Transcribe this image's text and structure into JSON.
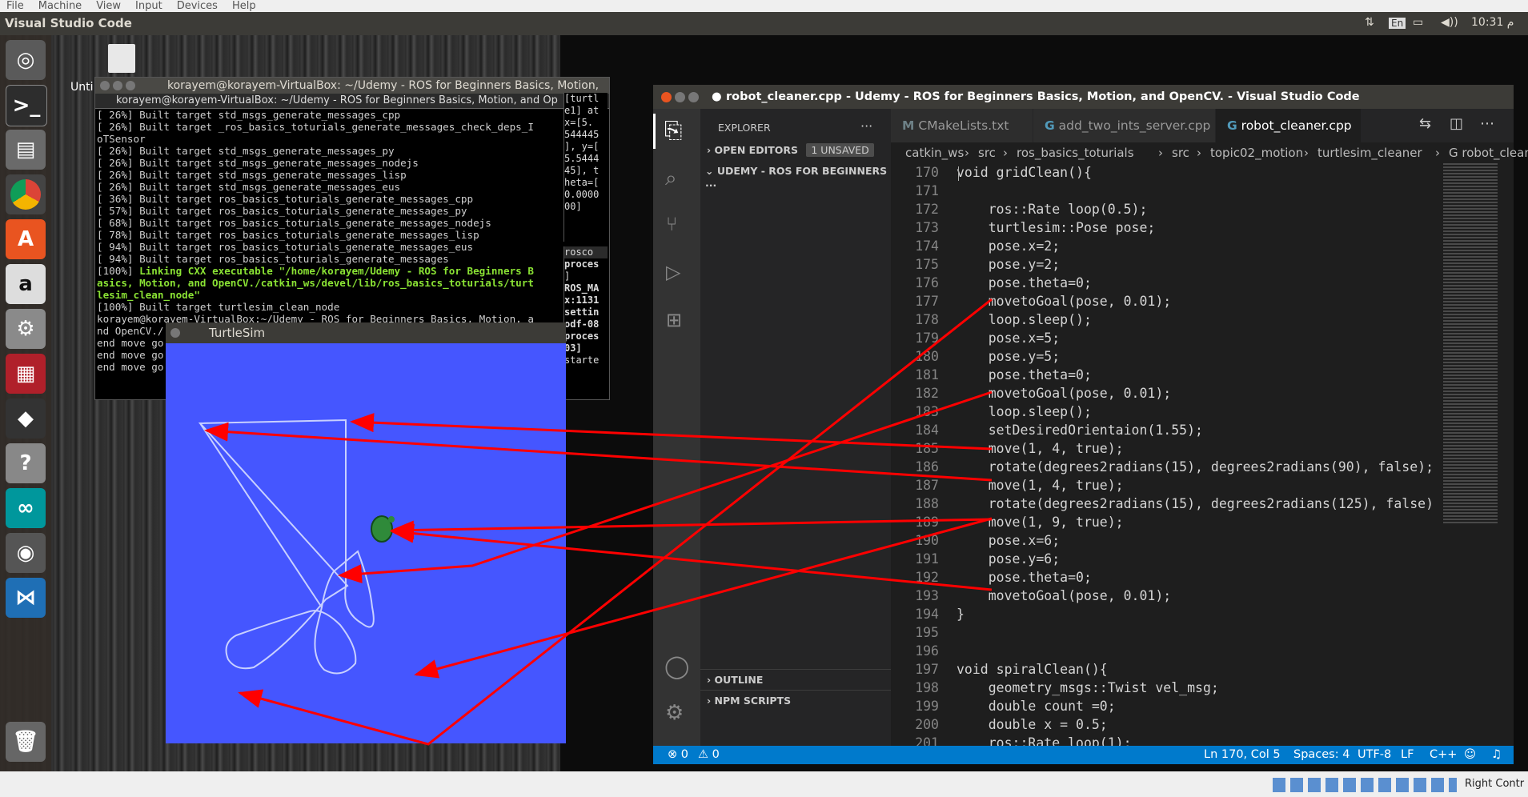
{
  "vbox_menu": [
    "File",
    "Machine",
    "View",
    "Input",
    "Devices",
    "Help"
  ],
  "top_panel": {
    "app_title": "Visual Studio Code",
    "indicators": [
      "⇅",
      "En",
      "▭",
      "◀))",
      "10:31 م"
    ]
  },
  "desktop": {
    "file_label": "Unti"
  },
  "terminal": {
    "window_title": "korayem@korayem-VirtualBox: ~/Udemy - ROS for Beginners Basics, Motion, a",
    "tab1": "korayem@korayem-VirtualBox: ~/Udemy - ROS for Beginners Basics, Motion, and Op",
    "tab2": "kora",
    "lines": [
      "[ 26%] Built target std_msgs_generate_messages_cpp",
      "[ 26%] Built target _ros_basics_toturials_generate_messages_check_deps_I",
      "oTSensor",
      "[ 26%] Built target std_msgs_generate_messages_py",
      "[ 26%] Built target std_msgs_generate_messages_nodejs",
      "[ 26%] Built target std_msgs_generate_messages_lisp",
      "[ 26%] Built target std_msgs_generate_messages_eus",
      "[ 36%] Built target ros_basics_toturials_generate_messages_cpp",
      "[ 57%] Built target ros_basics_toturials_generate_messages_py",
      "[ 68%] Built target ros_basics_toturials_generate_messages_nodejs",
      "[ 78%] Built target ros_basics_toturials_generate_messages_lisp",
      "[ 94%] Built target ros_basics_toturials_generate_messages_eus",
      "[ 94%] Built target ros_basics_toturials_generate_messages"
    ],
    "link_prefix": "[100%] ",
    "link_lines": [
      "Linking CXX executable \"/home/korayem/Udemy - ROS for Beginners B",
      "asics, Motion, and OpenCV./catkin_ws/devel/lib/ros_basics_toturials/turt",
      "lesim_clean_node\""
    ],
    "after_lines": [
      "[100%] Built target turtlesim_clean_node",
      "korayem@korayem-VirtualBox:~/Udemy - ROS for Beginners Basics, Motion, a",
      "nd OpenCV./",
      "end move go",
      "end move go",
      "end move go"
    ],
    "right_strip": [
      "[turtl",
      "e1] at",
      "x=[5.",
      "544445",
      "], y=[",
      "5.5444",
      "45], t",
      "heta=[",
      "0.0000",
      "00]"
    ],
    "roscore_title": "rosco",
    "roscore_lines": [
      "proces",
      "]",
      "ROS_MA",
      "x:1131",
      "",
      "settin",
      "odf-08",
      "proces",
      "03]",
      "starte"
    ]
  },
  "turtlesim": {
    "title": "TurtleSim"
  },
  "vscode": {
    "window_title": "robot_cleaner.cpp - Udemy - ROS for Beginners Basics, Motion, and OpenCV. - Visual Studio Code",
    "explorer_title": "EXPLORER",
    "explorer_more": "···",
    "open_editors": "OPEN EDITORS",
    "unsaved_badge": "1 UNSAVED",
    "folder": "UDEMY - ROS FOR BEGINNERS ...",
    "outline": "OUTLINE",
    "npm_scripts": "NPM SCRIPTS",
    "tabs": [
      {
        "icon": "M",
        "label": "CMakeLists.txt"
      },
      {
        "icon": "G",
        "label": "add_two_ints_server.cpp"
      },
      {
        "icon": "G",
        "label": "robot_cleaner.cpp"
      }
    ],
    "breadcrumb": [
      "catkin_ws",
      "src",
      "ros_basics_toturials",
      "src",
      "topic02_motion",
      "turtlesim_cleaner",
      "G robot_cleaner.cpp"
    ],
    "code": [
      {
        "n": "170",
        "t": "void gridClean(){"
      },
      {
        "n": "171",
        "t": ""
      },
      {
        "n": "172",
        "t": "    ros::Rate loop(0.5);"
      },
      {
        "n": "173",
        "t": "    turtlesim::Pose pose;"
      },
      {
        "n": "174",
        "t": "    pose.x=2;"
      },
      {
        "n": "175",
        "t": "    pose.y=2;"
      },
      {
        "n": "176",
        "t": "    pose.theta=0;"
      },
      {
        "n": "177",
        "t": "    movetoGoal(pose, 0.01);"
      },
      {
        "n": "178",
        "t": "    loop.sleep();"
      },
      {
        "n": "179",
        "t": "    pose.x=5;"
      },
      {
        "n": "180",
        "t": "    pose.y=5;"
      },
      {
        "n": "181",
        "t": "    pose.theta=0;"
      },
      {
        "n": "182",
        "t": "    movetoGoal(pose, 0.01);"
      },
      {
        "n": "183",
        "t": "    loop.sleep();"
      },
      {
        "n": "184",
        "t": "    setDesiredOrientaion(1.55);"
      },
      {
        "n": "185",
        "t": "    move(1, 4, true);"
      },
      {
        "n": "186",
        "t": "    rotate(degrees2radians(15), degrees2radians(90), false);"
      },
      {
        "n": "187",
        "t": "    move(1, 4, true);"
      },
      {
        "n": "188",
        "t": "    rotate(degrees2radians(15), degrees2radians(125), false)"
      },
      {
        "n": "189",
        "t": "    move(1, 9, true);"
      },
      {
        "n": "190",
        "t": "    pose.x=6;"
      },
      {
        "n": "191",
        "t": "    pose.y=6;"
      },
      {
        "n": "192",
        "t": "    pose.theta=0;"
      },
      {
        "n": "193",
        "t": "    movetoGoal(pose, 0.01);"
      },
      {
        "n": "194",
        "t": "}"
      },
      {
        "n": "195",
        "t": ""
      },
      {
        "n": "196",
        "t": ""
      },
      {
        "n": "197",
        "t": "void spiralClean(){"
      },
      {
        "n": "198",
        "t": "    geometry_msgs::Twist vel_msg;"
      },
      {
        "n": "199",
        "t": "    double count =0;"
      },
      {
        "n": "200",
        "t": "    double x = 0.5;"
      },
      {
        "n": "201",
        "t": "    ros::Rate loop(1);"
      }
    ],
    "status": {
      "errors": "⊗ 0",
      "warnings": "⚠ 0",
      "position": "Ln 170, Col 5",
      "spaces": "Spaces: 4",
      "encoding": "UTF-8",
      "eol": "LF",
      "language": "C++"
    }
  },
  "vbox_status": {
    "right_ctrl": "Right Contr"
  },
  "colors": {
    "arrow": "#ff0000",
    "turtle_bg": "#4556ff",
    "statusbar": "#007acc"
  }
}
